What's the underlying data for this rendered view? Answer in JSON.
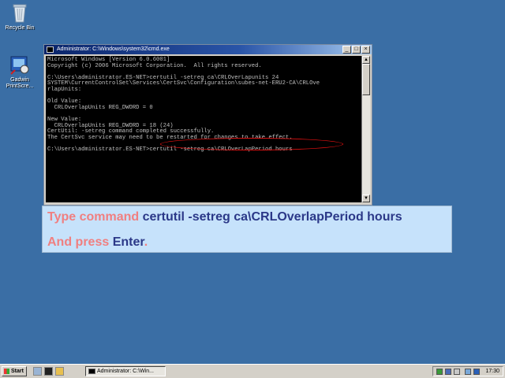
{
  "desktop": {
    "icons": [
      {
        "label": "Recycle Bin"
      },
      {
        "label": "Gadwin PrintScre..."
      }
    ]
  },
  "window": {
    "title": "Administrator: C:\\Windows\\system32\\cmd.exe",
    "buttons": {
      "minimize": "_",
      "maximize": "□",
      "close": "×"
    },
    "console_lines": [
      "Microsoft Windows [Version 6.0.6001]",
      "Copyright (c) 2006 Microsoft Corporation.  All rights reserved.",
      "",
      "C:\\Users\\administrator.ES-NET>certutil -setreg ca\\CRLOverLapunits 24",
      "SYSTEM\\CurrentControlSet\\Services\\CertSvc\\Configuration\\subes-net-ERU2-CA\\CRLOve",
      "rlapUnits:",
      "",
      "Old Value:",
      "  CRLOverlapUnits REG_DWORD = 0",
      "",
      "New Value:",
      "  CRLOverlapUnits REG_DWORD = 18 (24)",
      "CertUtil: -setreg command completed successfully.",
      "The CertSvc service may need to be restarted for changes to take effect.",
      "",
      "C:\\Users\\administrator.ES-NET>certutil -setreg ca\\CRLOverLapPeriod hours"
    ]
  },
  "instruction": {
    "line1_prefix": "Type command ",
    "line1_command": "certutil -setreg ca\\CRLOverlapPeriod hours",
    "line2_prefix": "And press ",
    "line2_key": "Enter",
    "line2_suffix": "."
  },
  "taskbar": {
    "start_label": "Start",
    "task_button_label": "Administrator: C:\\Win...",
    "clock": "17:30"
  },
  "colors": {
    "desktop": "#3a6ea5",
    "instruction_bg": "#c6e2fb",
    "instruction_pink": "#f07f80",
    "instruction_navy": "#2b3888",
    "highlight": "#e01010"
  }
}
